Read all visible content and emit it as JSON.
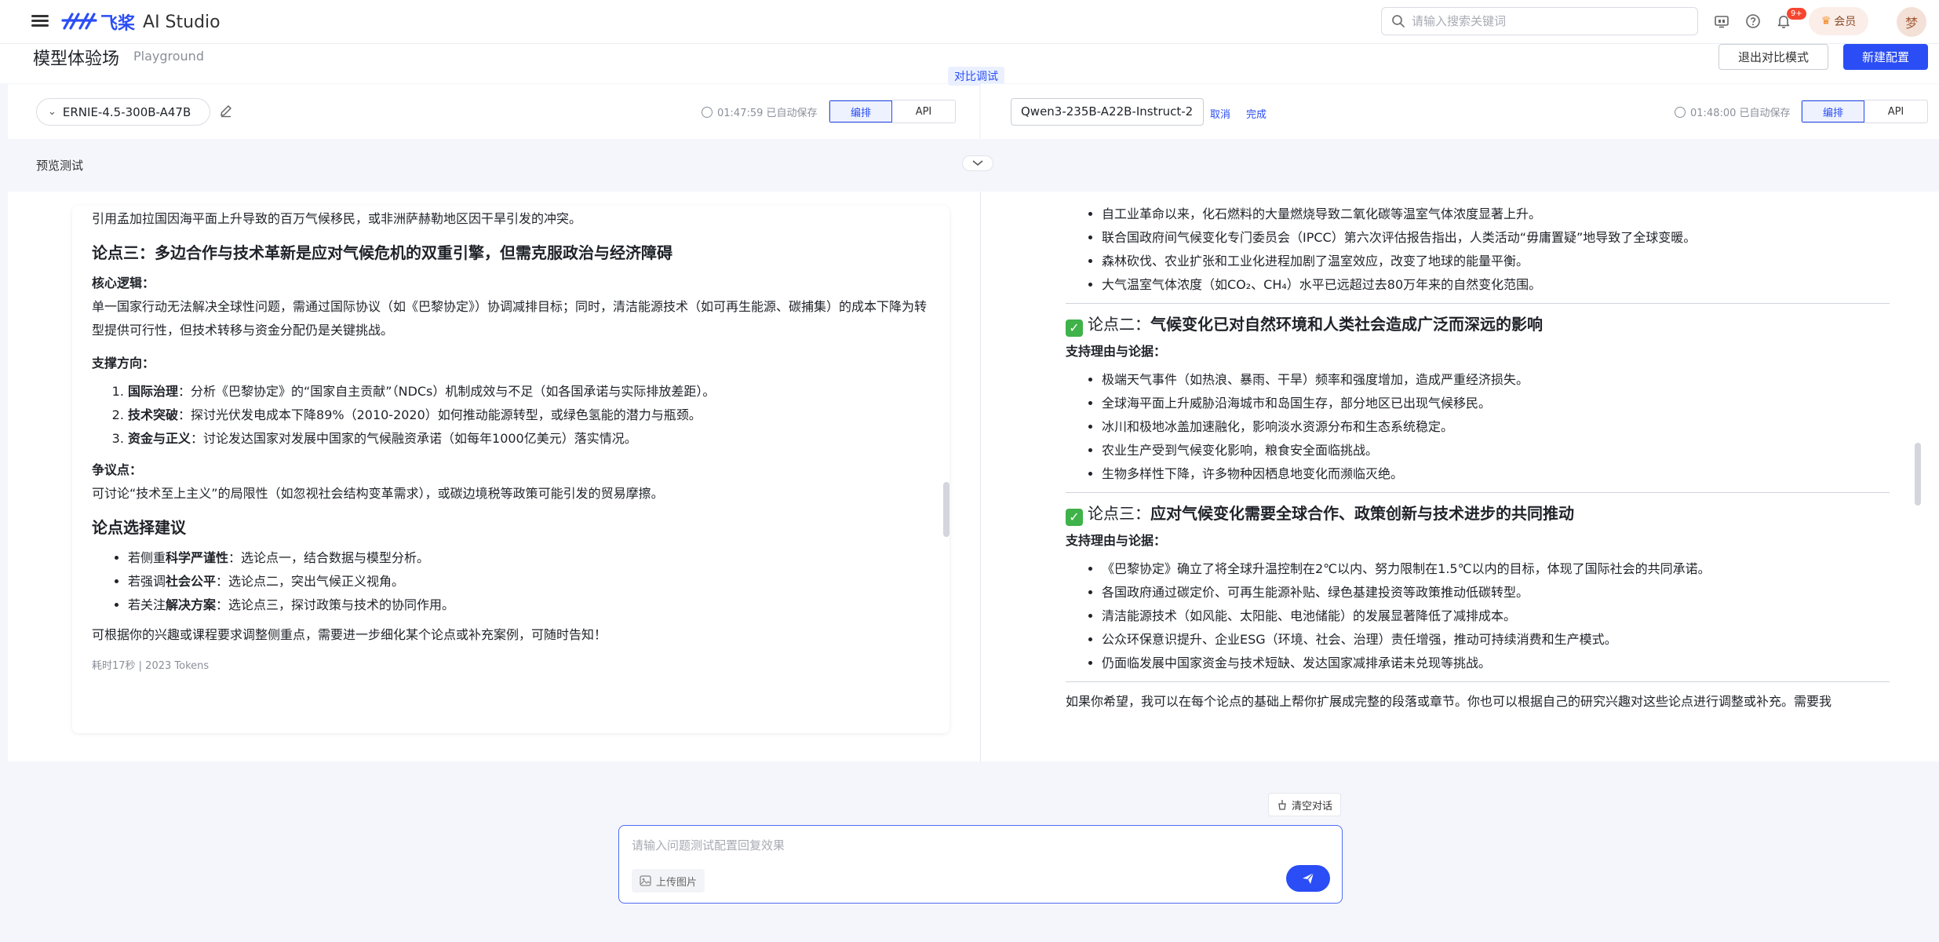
{
  "header": {
    "logo_mark": "ЯР",
    "logo_cn": "飞桨",
    "logo_studio": "AI Studio",
    "search_placeholder": "请输入搜索关键词",
    "notification_badge": "9+",
    "member_label": "会员",
    "avatar_text": "梦"
  },
  "page": {
    "title": "模型体验场",
    "subtitle": "Playground",
    "exit_compare": "退出对比模式",
    "new_config": "新建配置",
    "compare_tag": "对比调试"
  },
  "left_config": {
    "model": "ERNIE-4.5-300B-A47B",
    "autosave": "01:47:59 已自动保存",
    "tab_arrange": "编排",
    "tab_api": "API"
  },
  "right_config": {
    "model_name_value": "Qwen3-235B-A22B-Instruct-2",
    "cancel": "取消",
    "done": "完成",
    "autosave": "01:48:00 已自动保存",
    "tab_arrange": "编排",
    "tab_api": "API"
  },
  "preview": {
    "label": "预览测试"
  },
  "left_response": {
    "top_line": "引用孟加拉国因海平面上升导致的百万气候移民，或非洲萨赫勒地区因干旱引发的冲突。",
    "point3_title": "论点三：多边合作与技术革新是应对气候危机的双重引擎，但需克服政治与经济障碍",
    "core_logic_label": "核心逻辑",
    "core_logic_text": "单一国家行动无法解决全球性问题，需通过国际协议（如《巴黎协定》）协调减排目标；同时，清洁能源技术（如可再生能源、碳捕集）的成本下降为转型提供可行性，但技术转移与资金分配仍是关键挑战。",
    "support_label": "支撑方向",
    "support_items": [
      {
        "bold": "国际治理",
        "text": "：分析《巴黎协定》的“国家自主贡献”（NDCs）机制成效与不足（如各国承诺与实际排放差距）。"
      },
      {
        "bold": "技术突破",
        "text": "：探讨光伏发电成本下降89%（2010-2020）如何推动能源转型，或绿色氢能的潜力与瓶颈。"
      },
      {
        "bold": "资金与正义",
        "text": "：讨论发达国家对发展中国家的气候融资承诺（如每年1000亿美元）落实情况。"
      }
    ],
    "dispute_label": "争议点",
    "dispute_text": "可讨论“技术至上主义”的局限性（如忽视社会结构变革需求），或碳边境税等政策可能引发的贸易摩擦。",
    "suggest_title": "论点选择建议",
    "suggest_items": [
      {
        "pre": "若侧重",
        "bold": "科学严谨性",
        "text": "：选论点一，结合数据与模型分析。"
      },
      {
        "pre": "若强调",
        "bold": "社会公平",
        "text": "：选论点二，突出气候正义视角。"
      },
      {
        "pre": "若关注",
        "bold": "解决方案",
        "text": "：选论点三，探讨政策与技术的协同作用。"
      }
    ],
    "closing": "可根据你的兴趣或课程要求调整侧重点，需要进一步细化某个论点或补充案例，可随时告知！",
    "meta": "耗时17秒 | 2023 Tokens"
  },
  "right_response": {
    "top_items": [
      "自工业革命以来，化石燃料的大量燃烧导致二氧化碳等温室气体浓度显著上升。",
      "联合国政府间气候变化专门委员会（IPCC）第六次评估报告指出，人类活动“毋庸置疑”地导致了全球变暖。",
      "森林砍伐、农业扩张和工业化进程加剧了温室效应，改变了地球的能量平衡。",
      "大气温室气体浓度（如CO₂、CH₄）水平已远超过去80万年来的自然变化范围。"
    ],
    "point2_prefix": "论点二：",
    "point2_title": "气候变化已对自然环境和人类社会造成广泛而深远的影响",
    "support_label": "支持理由与论据：",
    "point2_items": [
      "极端天气事件（如热浪、暴雨、干旱）频率和强度增加，造成严重经济损失。",
      "全球海平面上升威胁沿海城市和岛国生存，部分地区已出现气候移民。",
      "冰川和极地冰盖加速融化，影响淡水资源分布和生态系统稳定。",
      "农业生产受到气候变化影响，粮食安全面临挑战。",
      "生物多样性下降，许多物种因栖息地变化而濒临灭绝。"
    ],
    "point3_prefix": "论点三：",
    "point3_title": "应对气候变化需要全球合作、政策创新与技术进步的共同推动",
    "point3_items": [
      "《巴黎协定》确立了将全球升温控制在2℃以内、努力限制在1.5℃以内的目标，体现了国际社会的共同承诺。",
      "各国政府通过碳定价、可再生能源补贴、绿色基建投资等政策推动低碳转型。",
      "清洁能源技术（如风能、太阳能、电池储能）的发展显著降低了减排成本。",
      "公众环保意识提升、企业ESG（环境、社会、治理）责任增强，推动可持续消费和生产模式。",
      "仍面临发展中国家资金与技术短缺、发达国家减排承诺未兑现等挑战。"
    ],
    "closing": "如果你希望，我可以在每个论点的基础上帮你扩展成完整的段落或章节。你也可以根据自己的研究兴趣对这些论点进行调整或补充。需要我"
  },
  "chat": {
    "clear_label": "清空对话",
    "input_placeholder": "请输入问题测试配置回复效果",
    "upload_label": "上传图片"
  }
}
